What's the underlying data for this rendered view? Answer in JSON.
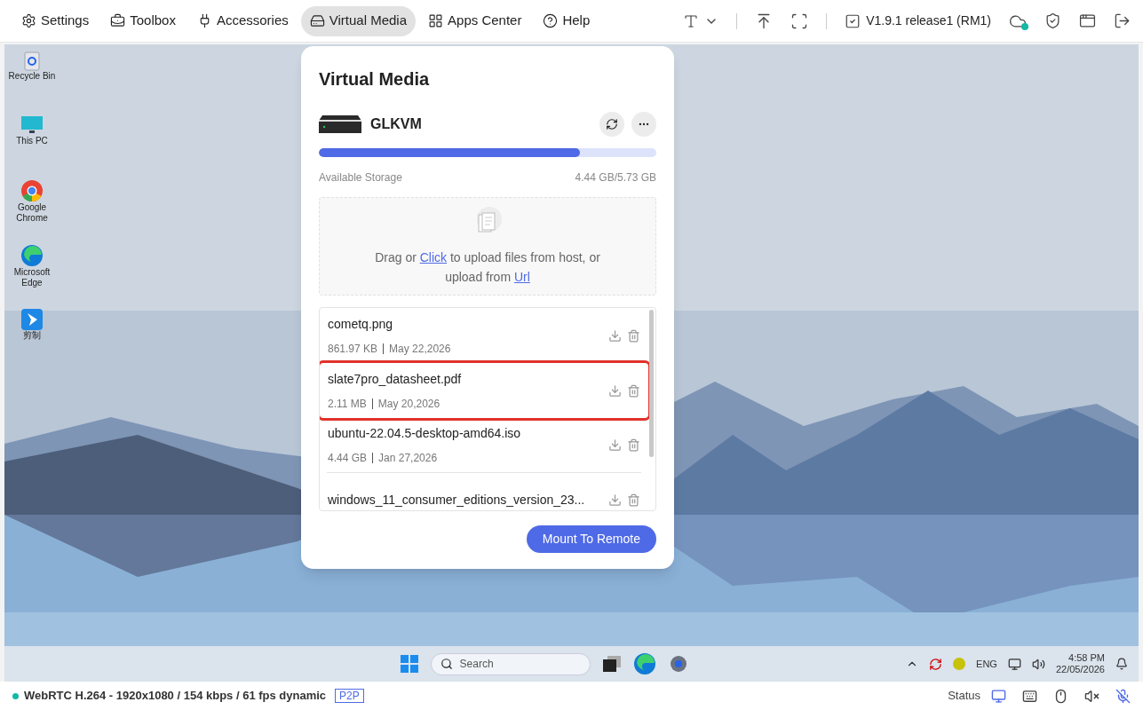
{
  "top_nav": [
    {
      "label": "Settings",
      "selected": false
    },
    {
      "label": "Toolbox",
      "selected": false
    },
    {
      "label": "Accessories",
      "selected": false
    },
    {
      "label": "Virtual Media",
      "selected": true
    },
    {
      "label": "Apps Center",
      "selected": false
    },
    {
      "label": "Help",
      "selected": false
    }
  ],
  "version": "V1.9.1 release1 (RM1)",
  "desktop_icons": [
    {
      "label": "Recycle Bin"
    },
    {
      "label": "This PC"
    },
    {
      "label": "Google Chrome"
    },
    {
      "label": "Microsoft Edge"
    },
    {
      "label": "剪制"
    }
  ],
  "dialog": {
    "title": "Virtual Media",
    "device": "GLKVM",
    "storage": {
      "label": "Available Storage",
      "reading": "4.44 GB/5.73 GB",
      "level": 0.774
    },
    "upload": {
      "before": "Drag or ",
      "link1": "Click",
      "middle": " to upload files from host, or upload from ",
      "link2": "Url"
    },
    "files": [
      {
        "name": "cometq.png",
        "size": "861.97 KB",
        "date": "May 22,2026",
        "highlighted": false
      },
      {
        "name": "slate7pro_datasheet.pdf",
        "size": "2.11 MB",
        "date": "May 20,2026",
        "highlighted": true
      },
      {
        "name": "ubuntu-22.04.5-desktop-amd64.iso",
        "size": "4.44 GB",
        "date": "Jan 27,2026",
        "highlighted": false
      },
      {
        "name": "windows_11_consumer_editions_version_23..."
      }
    ],
    "mount_button": "Mount To Remote"
  },
  "taskbar": {
    "search_placeholder": "Search",
    "language": "ENG",
    "time": "4:58 PM",
    "date": "22/05/2026"
  },
  "status_bar": {
    "stream": "WebRTC H.264 - 1920x1080 / 154 kbps / 61 fps dynamic",
    "mode": "P2P",
    "status_label": "Status"
  }
}
